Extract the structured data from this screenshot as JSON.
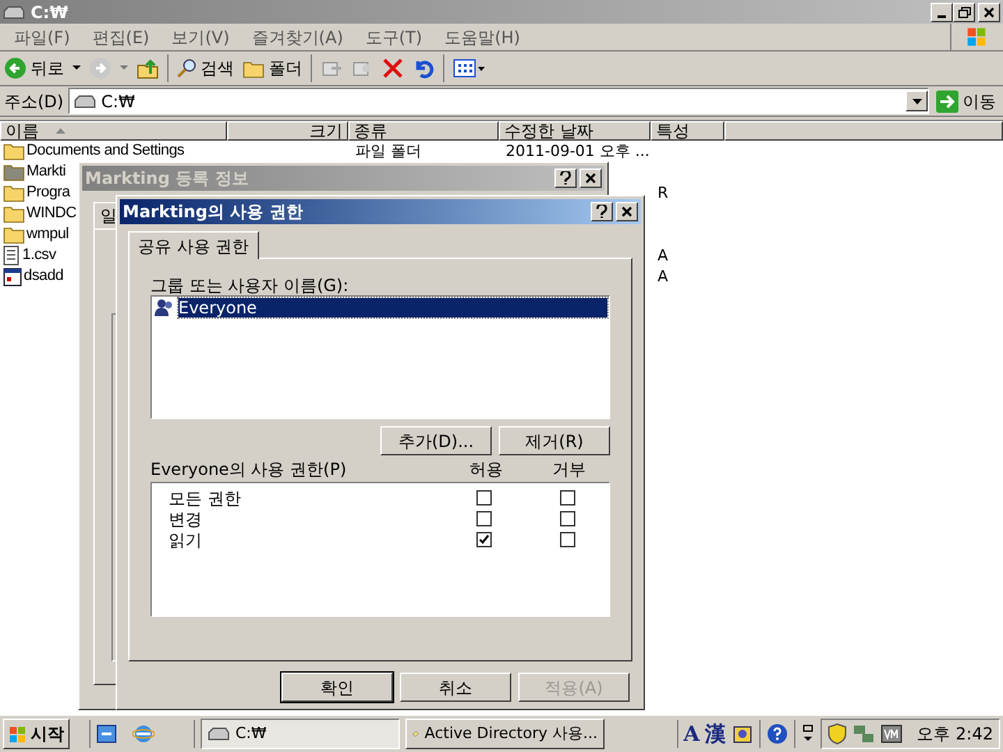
{
  "window": {
    "title": "C:₩"
  },
  "menu": [
    "파일(F)",
    "편집(E)",
    "보기(V)",
    "즐겨찾기(A)",
    "도구(T)",
    "도움말(H)"
  ],
  "toolbar": {
    "back": "뒤로",
    "search": "검색",
    "folders": "폴더"
  },
  "address": {
    "label": "주소(D)",
    "value": "C:₩",
    "go": "이동"
  },
  "columns": [
    "이름",
    "크기",
    "종류",
    "수정한 날짜",
    "특성"
  ],
  "files": [
    {
      "name": "Documents and Settings",
      "kind": "folder",
      "type": "파일 폴더",
      "modified": "2011-09-01 오후 ..."
    },
    {
      "name": "Markti",
      "kind": "shared-folder"
    },
    {
      "name": "Progra",
      "kind": "folder",
      "attributes": "R"
    },
    {
      "name": "WINDC",
      "kind": "folder"
    },
    {
      "name": "wmpul",
      "kind": "folder"
    },
    {
      "name": "1.csv",
      "kind": "text",
      "attributes": "A"
    },
    {
      "name": "dsadd",
      "kind": "program",
      "attributes": "A"
    }
  ],
  "properties_dialog": {
    "title": "Markting 등록 정보",
    "tab": "일"
  },
  "permissions_dialog": {
    "title": "Markting의 사용 권한",
    "tabs": [
      {
        "label": "공유 사용 권한",
        "selected": true
      }
    ],
    "users_label": "그룹 또는 사용자 이름(G):",
    "users": [
      {
        "name": "Everyone",
        "selected": true
      }
    ],
    "add_button": "추가(D)...",
    "remove_button": "제거(R)",
    "permissions_label": "Everyone의 사용 권한(P)",
    "allow_header": "허용",
    "deny_header": "거부",
    "permissions": [
      {
        "name": "모든 권한",
        "allow": false,
        "deny": false
      },
      {
        "name": "변경",
        "allow": false,
        "deny": false
      },
      {
        "name": "읽기",
        "allow": true,
        "deny": false
      }
    ],
    "buttons": [
      {
        "label": "확인",
        "disabled": false,
        "default": true
      },
      {
        "label": "취소",
        "disabled": false,
        "default": false
      },
      {
        "label": "적용(A)",
        "disabled": true,
        "default": false
      }
    ]
  },
  "taskbar": {
    "start": "시작",
    "tasks": [
      {
        "label": "C:₩",
        "selected": true
      },
      {
        "label": "Active Directory 사용...",
        "selected": false
      }
    ],
    "tray_text": [
      "A",
      "漢"
    ],
    "clock": "오후 2:42"
  }
}
